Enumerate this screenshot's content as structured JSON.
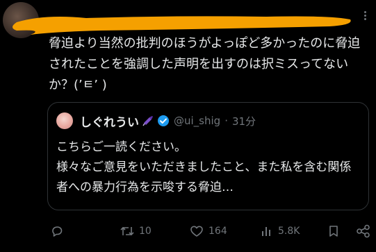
{
  "tweet": {
    "text": "脅迫より当然の批判のほうがよっぽど多かったのに脅迫されたことを強調した声明を出すのは択ミスってないか？(’ㅌ’ )"
  },
  "quote": {
    "name": "しぐれうい",
    "name_emoji": "umbrella-icon",
    "verified_icon": "verified-badge-icon",
    "handle": "@ui_shig",
    "separator": "·",
    "time": "31分",
    "text": "こちらご一読ください。\n様々なご意見をいただきましたこと、また私を含む関係者への暴力行為を示唆する脅迫…"
  },
  "actions": {
    "reply_icon": "reply-icon",
    "retweet_icon": "retweet-icon",
    "retweet_count": "10",
    "like_icon": "heart-icon",
    "like_count": "164",
    "views_icon": "views-icon",
    "views_count": "5.8K",
    "bookmark_icon": "bookmark-icon",
    "share_icon": "share-icon"
  },
  "colors": {
    "background": "#000000",
    "text": "#e7e9ea",
    "muted": "#71767b",
    "border": "#2f3336",
    "verified": "#1d9bf0",
    "redaction": "#f5a000"
  }
}
